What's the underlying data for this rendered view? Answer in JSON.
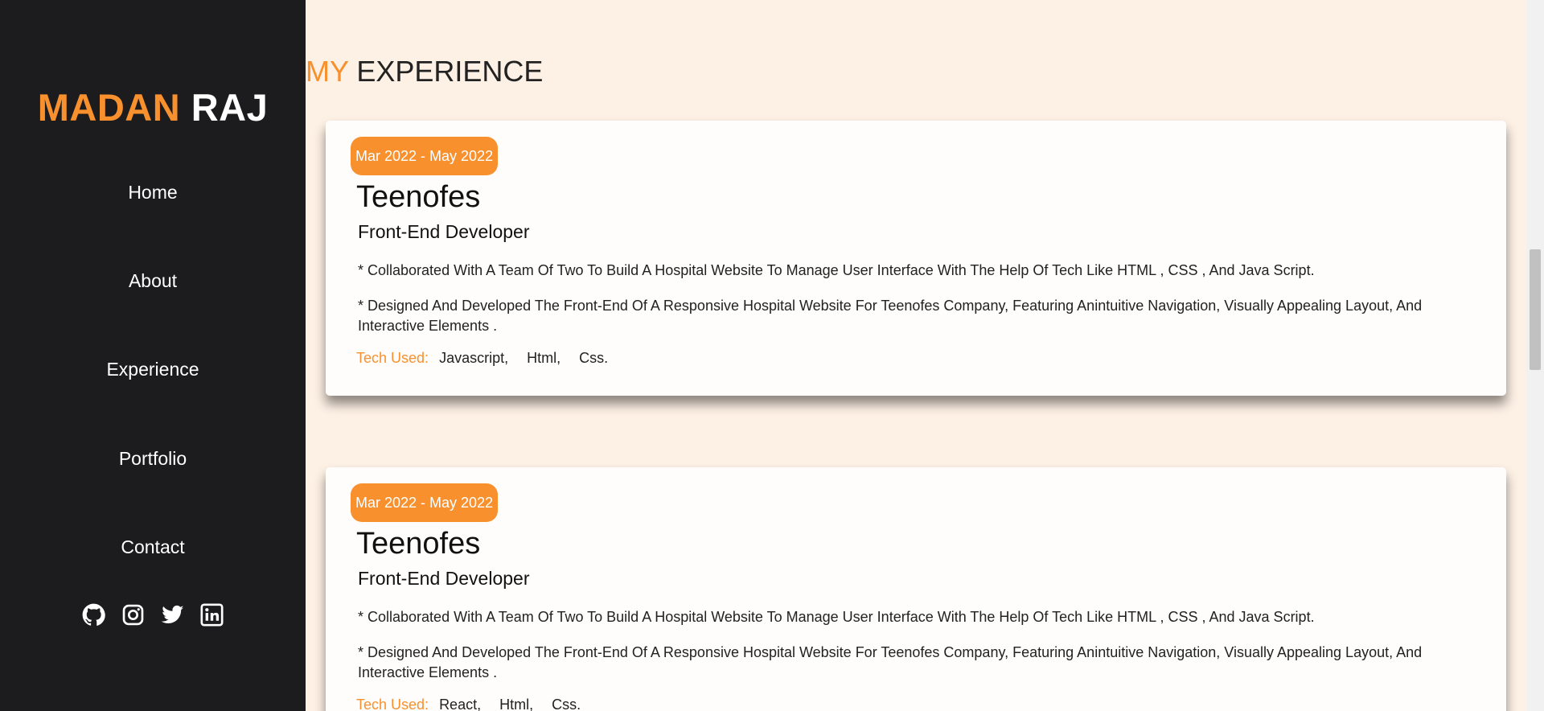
{
  "brand": {
    "first": "MADAN",
    "last": "RAJ"
  },
  "nav": [
    "Home",
    "About",
    "Experience",
    "Portfolio",
    "Contact"
  ],
  "socials": [
    "github-icon",
    "instagram-icon",
    "twitter-icon",
    "linkedin-icon"
  ],
  "section": {
    "title_highlight": "MY",
    "title_rest": "EXPERIENCE"
  },
  "experiences": [
    {
      "date": "Mar 2022 - May 2022",
      "company": "Teenofes",
      "role": "Front-End Developer",
      "bullets": [
        "* Collaborated With A Team Of Two To Build A Hospital Website To Manage User Interface With The Help Of Tech Like HTML , CSS , And Java Script.",
        "* Designed And Developed The Front-End Of A Responsive Hospital Website For Teenofes Company, Featuring Anintuitive Navigation, Visually Appealing Layout, And Interactive Elements ."
      ],
      "tech_label": "Tech Used:",
      "tech": [
        "Javascript,",
        "Html,",
        "Css."
      ]
    },
    {
      "date": "Mar 2022 - May 2022",
      "company": "Teenofes",
      "role": "Front-End Developer",
      "bullets": [
        "* Collaborated With A Team Of Two To Build A Hospital Website To Manage User Interface With The Help Of Tech Like HTML , CSS , And Java Script.",
        "* Designed And Developed The Front-End Of A Responsive Hospital Website For Teenofes Company, Featuring Anintuitive Navigation, Visually Appealing Layout, And Interactive Elements ."
      ],
      "tech_label": "Tech Used:",
      "tech": [
        "React,",
        "Html,",
        "Css."
      ]
    }
  ],
  "colors": {
    "accent": "#f8902d",
    "sidebar": "#1c1b1d",
    "background": "#fdf0e4"
  }
}
